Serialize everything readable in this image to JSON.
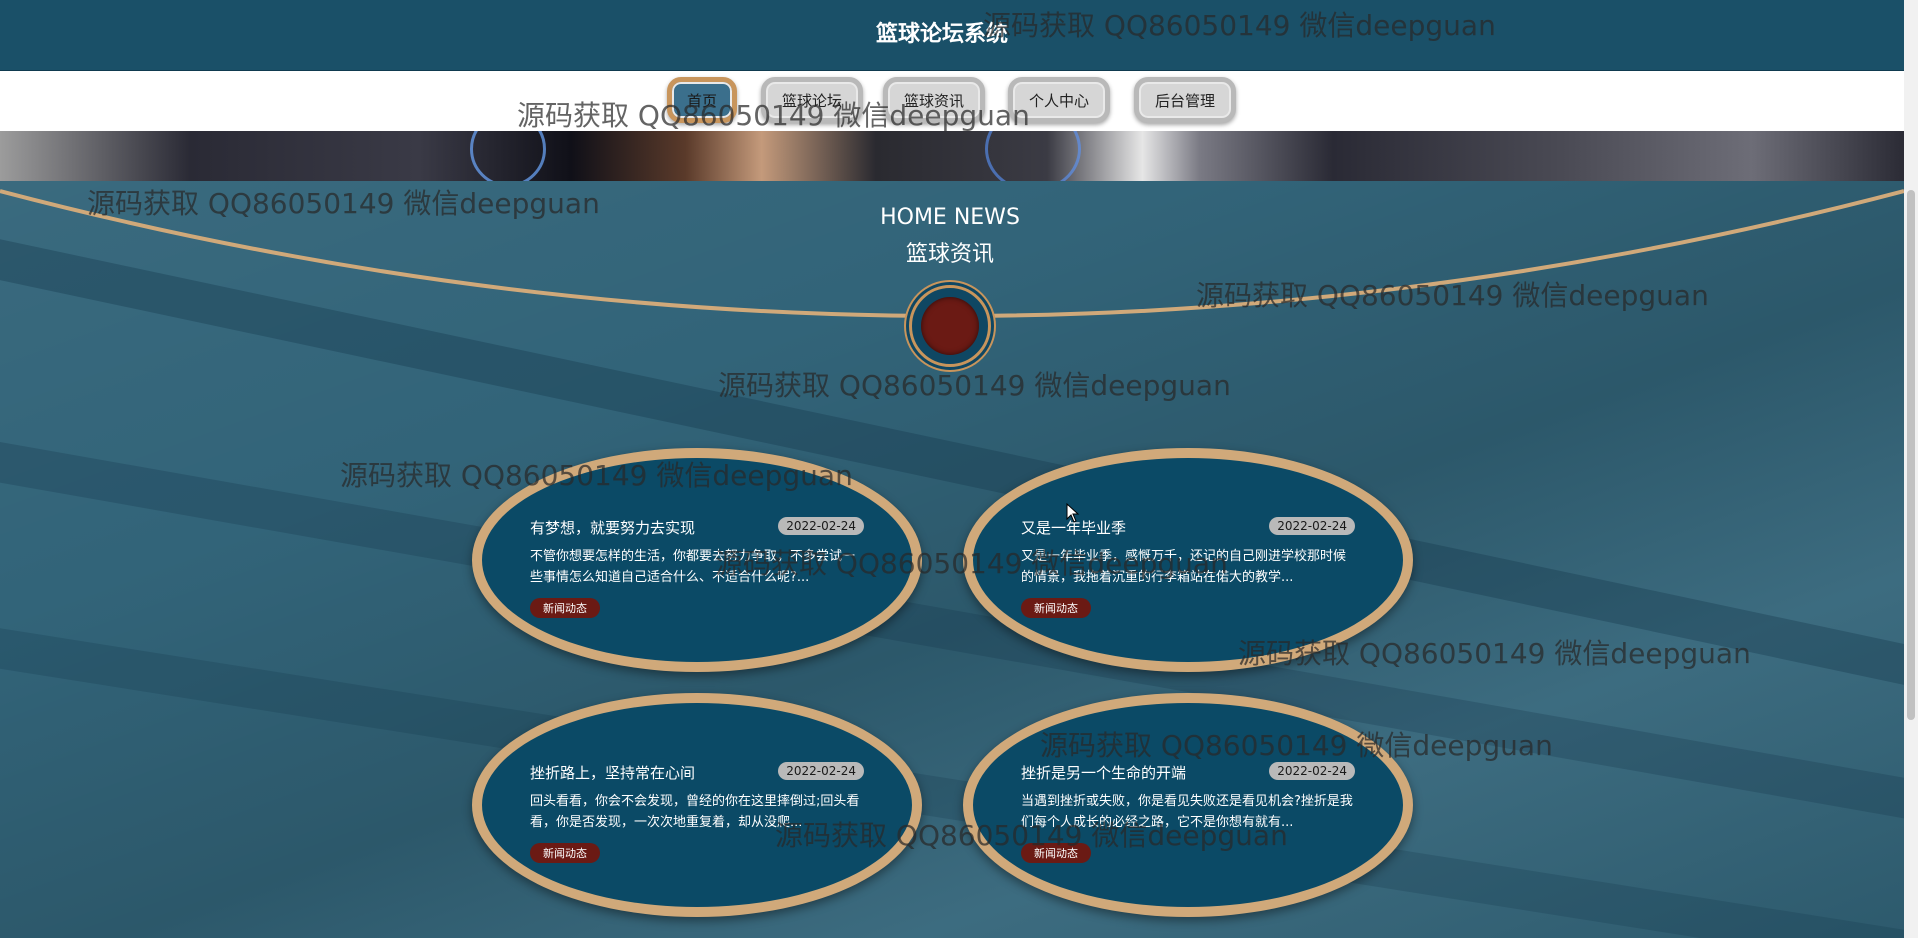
{
  "header": {
    "title": "篮球论坛系统"
  },
  "nav": {
    "items": [
      {
        "label": "首页",
        "active": true
      },
      {
        "label": "篮球论坛",
        "active": false
      },
      {
        "label": "篮球资讯",
        "active": false
      },
      {
        "label": "个人中心",
        "active": false
      },
      {
        "label": "后台管理",
        "active": false
      }
    ]
  },
  "section": {
    "title_en": "HOME NEWS",
    "title_cn": "篮球资讯"
  },
  "news": [
    {
      "title": "有梦想，就要努力去实现",
      "date": "2022-02-24",
      "desc": "不管你想要怎样的生活，你都要去努力争取，不多尝试一些事情怎么知道自己适合什么、不适合什么呢?...",
      "tag": "新闻动态"
    },
    {
      "title": "又是一年毕业季",
      "date": "2022-02-24",
      "desc": "又是一年毕业季，感慨万千，还记的自己刚进学校那时候的情景，我拖着沉重的行李箱站在偌大的教学...",
      "tag": "新闻动态"
    },
    {
      "title": "挫折路上，坚持常在心间",
      "date": "2022-02-24",
      "desc": "回头看看，你会不会发现，曾经的你在这里摔倒过;回头看看，你是否发现，一次次地重复着，却从没爬...",
      "tag": "新闻动态"
    },
    {
      "title": "挫折是另一个生命的开端",
      "date": "2022-02-24",
      "desc": "当遇到挫折或失败，你是看见失败还是看见机会?挫折是我们每个人成长的必经之路，它不是你想有就有...",
      "tag": "新闻动态"
    }
  ],
  "watermark": {
    "text": "源码获取 QQ86050149 微信deepguan"
  },
  "colors": {
    "header_bg": "#1a5068",
    "card_bg": "#0b4a66",
    "card_border": "#d0a97a",
    "tag_bg": "#6b1a14",
    "date_bg": "#b9b9b9"
  }
}
